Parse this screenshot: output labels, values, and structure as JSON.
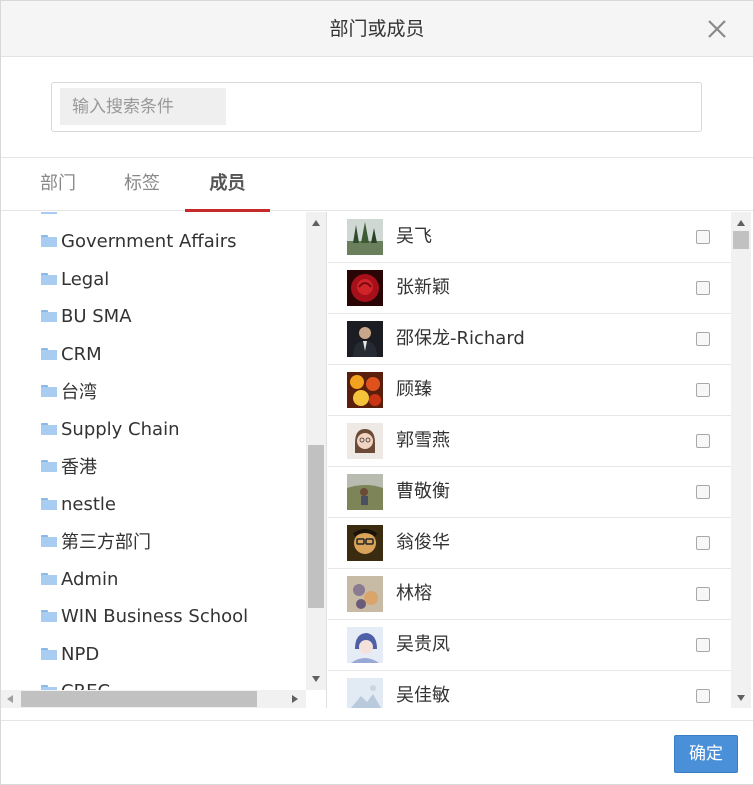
{
  "dialog": {
    "title": "部门或成员",
    "close_icon": "close-icon"
  },
  "search": {
    "placeholder": "输入搜索条件",
    "value": ""
  },
  "tabs": [
    {
      "label": "部门",
      "active": false
    },
    {
      "label": "标签",
      "active": false
    },
    {
      "label": "成员",
      "active": true
    }
  ],
  "departments": [
    {
      "label": "Government Affairs"
    },
    {
      "label": "Legal"
    },
    {
      "label": "BU SMA"
    },
    {
      "label": "CRM"
    },
    {
      "label": "台湾"
    },
    {
      "label": "Supply Chain"
    },
    {
      "label": "香港"
    },
    {
      "label": "nestle"
    },
    {
      "label": "第三方部门"
    },
    {
      "label": "Admin"
    },
    {
      "label": "WIN Business School"
    },
    {
      "label": "NPD"
    },
    {
      "label": "CREC"
    }
  ],
  "members": [
    {
      "name": "吴飞",
      "checked": false
    },
    {
      "name": "张新颖",
      "checked": false
    },
    {
      "name": "邵保龙-Richard",
      "checked": false
    },
    {
      "name": "顾臻",
      "checked": false
    },
    {
      "name": "郭雪燕",
      "checked": false
    },
    {
      "name": "曹敬衡",
      "checked": false
    },
    {
      "name": "翁俊华",
      "checked": false
    },
    {
      "name": "林榕",
      "checked": false
    },
    {
      "name": "吴贵凤",
      "checked": false
    },
    {
      "name": "吴佳敏",
      "checked": false
    }
  ],
  "footer": {
    "confirm_label": "确定"
  },
  "colors": {
    "accent": "#4a90d9",
    "active_tab_underline": "#c62b2b",
    "folder": "#a9cdf1"
  }
}
